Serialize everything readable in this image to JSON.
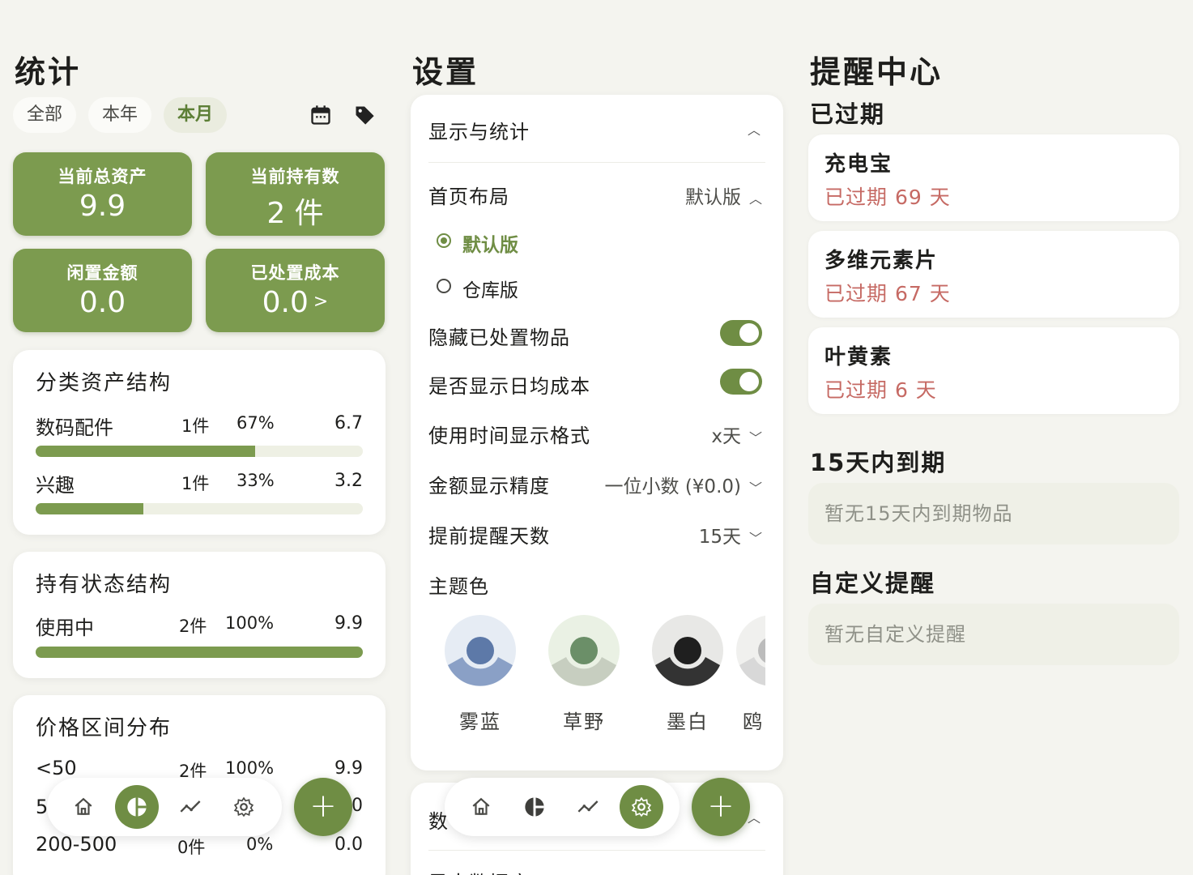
{
  "stats": {
    "title": "统计",
    "filters": [
      "全部",
      "本年",
      "本月"
    ],
    "active_filter": "本月",
    "cards": [
      {
        "label": "当前总资产",
        "value": "9.9"
      },
      {
        "label": "当前持有数",
        "value": "2 件"
      },
      {
        "label": "闲置金额",
        "value": "0.0"
      },
      {
        "label": "已处置成本",
        "value": "0.0",
        "arrow": ">"
      }
    ],
    "category": {
      "title": "分类资产结构",
      "rows": [
        {
          "name": "数码配件",
          "count": "1件",
          "pct": "67%",
          "amount": "6.7",
          "fill": 0.67
        },
        {
          "name": "兴趣",
          "count": "1件",
          "pct": "33%",
          "amount": "3.2",
          "fill": 0.33
        }
      ]
    },
    "status": {
      "title": "持有状态结构",
      "rows": [
        {
          "name": "使用中",
          "count": "2件",
          "pct": "100%",
          "amount": "9.9",
          "fill": 1.0
        }
      ]
    },
    "price": {
      "title": "价格区间分布",
      "rows": [
        {
          "name": "<50",
          "count": "2件",
          "pct": "100%",
          "amount": "9.9"
        },
        {
          "name": "5",
          "amount": "0"
        },
        {
          "name": "200-500",
          "count": "0件",
          "pct": "0%",
          "amount": "0.0"
        }
      ]
    }
  },
  "settings": {
    "title": "设置",
    "section_display": "显示与统计",
    "home_layout": {
      "label": "首页布局",
      "value": "默认版"
    },
    "layout_options": [
      "默认版",
      "仓库版"
    ],
    "hide_disposed": "隐藏已处置物品",
    "show_daily_cost": "是否显示日均成本",
    "time_format": {
      "label": "使用时间显示格式",
      "value": "x天"
    },
    "amount_precision": {
      "label": "金额显示精度",
      "value": "一位小数 (¥0.0)"
    },
    "remind_days": {
      "label": "提前提醒天数",
      "value": "15天"
    },
    "theme_label": "主题色",
    "themes": [
      {
        "name": "雾蓝",
        "inner": "#5d79a8",
        "ring": "#8aa0c6",
        "bg": "#e6ecf4"
      },
      {
        "name": "草野",
        "inner": "#6b8f68",
        "ring": "#c7cec0",
        "bg": "#eaf1e4"
      },
      {
        "name": "墨白",
        "inner": "#1f1f1f",
        "ring": "#333333",
        "bg": "#e8e8e6"
      },
      {
        "name": "鸥",
        "inner": "#bcbcbc",
        "ring": "#d8d8d8",
        "bg": "#f0f0ee"
      }
    ],
    "section_data_partial": "数",
    "data_row_partial": "导出数据库"
  },
  "reminders": {
    "title": "提醒中心",
    "expired_title": "已过期",
    "expired": [
      {
        "name": "充电宝",
        "status": "已过期 69 天"
      },
      {
        "name": "多维元素片",
        "status": "已过期 67 天"
      },
      {
        "name": "叶黄素",
        "status": "已过期 6 天"
      }
    ],
    "soon_title": "15天内到期",
    "soon_empty": "暂无15天内到期物品",
    "custom_title": "自定义提醒",
    "custom_empty": "暂无自定义提醒"
  },
  "nav": {
    "fab_label": "+"
  },
  "colors": {
    "accent": "#7c9b4f",
    "accent_dark": "#6f8d44",
    "expired_text": "#c66a64",
    "background": "#f4f4ef"
  }
}
